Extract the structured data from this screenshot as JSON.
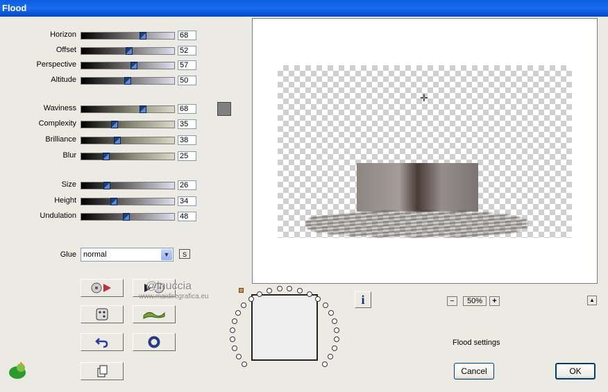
{
  "window": {
    "title": "Flood"
  },
  "sliders": {
    "horizon": {
      "label": "Horizon",
      "value": "68"
    },
    "offset": {
      "label": "Offset",
      "value": "52"
    },
    "perspective": {
      "label": "Perspective",
      "value": "57"
    },
    "altitude": {
      "label": "Altitude",
      "value": "50"
    },
    "waviness": {
      "label": "Waviness",
      "value": "68"
    },
    "complexity": {
      "label": "Complexity",
      "value": "35"
    },
    "brilliance": {
      "label": "Brilliance",
      "value": "38"
    },
    "blur": {
      "label": "Blur",
      "value": "25"
    },
    "size": {
      "label": "Size",
      "value": "26"
    },
    "height": {
      "label": "Height",
      "value": "34"
    },
    "undulation": {
      "label": "Undulation",
      "value": "48"
    }
  },
  "glue": {
    "label": "Glue",
    "value": "normal",
    "s_button": "S"
  },
  "color_swatch": "#808080",
  "watermark": {
    "line1": "@inuccia",
    "line2": "www.maidiregrafica.eu"
  },
  "zoom": {
    "minus": "−",
    "value": "50%",
    "plus": "+"
  },
  "status": "Flood settings",
  "buttons": {
    "cancel": "Cancel",
    "ok": "OK",
    "up": "▲",
    "info": "i"
  }
}
